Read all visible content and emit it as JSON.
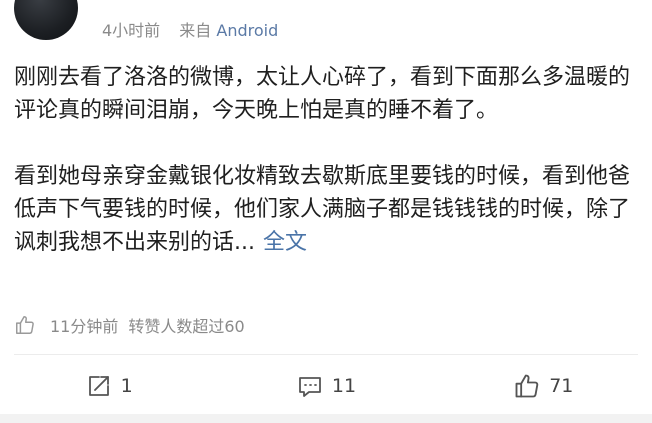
{
  "header": {
    "time": "4小时前",
    "source_prefix": "来自",
    "source_device": "Android"
  },
  "post": {
    "paragraph1": "刚刚去看了洛洛的微博，太让人心碎了，看到下面那么多温暖的评论真的瞬间泪崩，今天晚上怕是真的睡不着了。",
    "paragraph2": "看到她母亲穿金戴银化妆精致去歇斯底里要钱的时候，看到他爸低声下气要钱的时候，他们家人满脑子都是钱钱钱的时候，除了讽刺我想不出来别的话",
    "ellipsis": "...",
    "full_text_label": "全文"
  },
  "status": {
    "time": "11分钟前",
    "forward_stat": "转赞人数超过60",
    "icon": "thumbs-up-icon"
  },
  "actions": {
    "repost": {
      "icon": "repost-icon",
      "count": "1"
    },
    "comment": {
      "icon": "comment-icon",
      "count": "11"
    },
    "like": {
      "icon": "thumbs-up-icon",
      "count": "71"
    }
  },
  "colors": {
    "link": "#4a74a8",
    "device": "#5b7aa6",
    "meta": "#8a8a8a",
    "text": "#1f1f1f"
  }
}
